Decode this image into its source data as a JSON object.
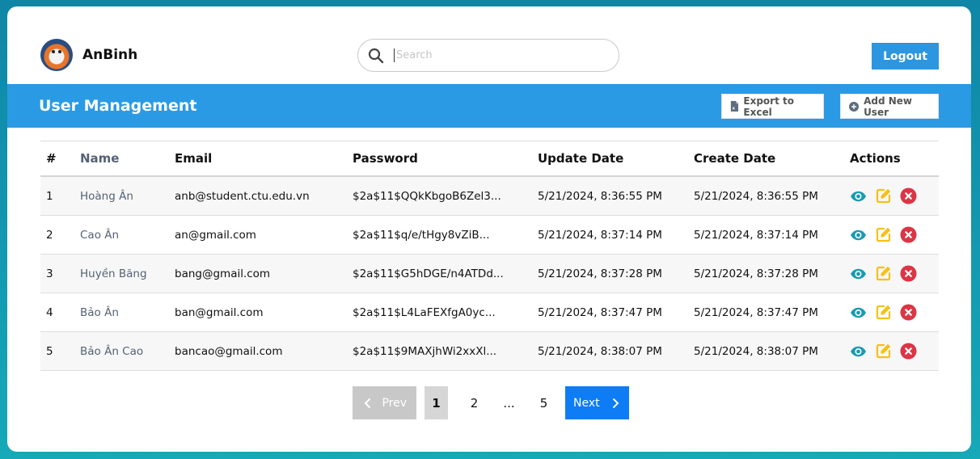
{
  "header": {
    "username": "AnBinh",
    "search_placeholder": "Search",
    "logout_label": "Logout"
  },
  "titlebar": {
    "title": "User Management",
    "export_label": "Export to Excel",
    "add_label": "Add New User"
  },
  "table": {
    "columns": [
      "#",
      "Name",
      "Email",
      "Password",
      "Update Date",
      "Create Date",
      "Actions"
    ],
    "rows": [
      {
        "num": "1",
        "name": "Hoàng Ân",
        "email": "anb@student.ctu.edu.vn",
        "password": "$2a$11$QQkKbgoB6Zel3...",
        "updated": "5/21/2024, 8:36:55 PM",
        "created": "5/21/2024, 8:36:55 PM"
      },
      {
        "num": "2",
        "name": "Cao Ân",
        "email": "an@gmail.com",
        "password": "$2a$11$q/e/tHgy8vZiB...",
        "updated": "5/21/2024, 8:37:14 PM",
        "created": "5/21/2024, 8:37:14 PM"
      },
      {
        "num": "3",
        "name": "Huyền Băng",
        "email": "bang@gmail.com",
        "password": "$2a$11$G5hDGE/n4ATDd...",
        "updated": "5/21/2024, 8:37:28 PM",
        "created": "5/21/2024, 8:37:28 PM"
      },
      {
        "num": "4",
        "name": "Bảo Ân",
        "email": "ban@gmail.com",
        "password": "$2a$11$L4LaFEXfgA0yc...",
        "updated": "5/21/2024, 8:37:47 PM",
        "created": "5/21/2024, 8:37:47 PM"
      },
      {
        "num": "5",
        "name": "Bảo Ân Cao",
        "email": "bancao@gmail.com",
        "password": "$2a$11$9MAXjhWi2xxXl...",
        "updated": "5/21/2024, 8:38:07 PM",
        "created": "5/21/2024, 8:38:07 PM"
      }
    ]
  },
  "pagination": {
    "prev_label": "Prev",
    "next_label": "Next",
    "pages": [
      "1",
      "2",
      "...",
      "5"
    ],
    "current": "1"
  },
  "colors": {
    "primary": "#2b9ae4",
    "view_icon": "#1a9bb0",
    "edit_icon": "#f6c019",
    "delete_icon": "#dc3545"
  },
  "icons": [
    "avatar",
    "search-icon",
    "excel-file-icon",
    "plus-circle-icon",
    "eye-icon",
    "edit-icon",
    "delete-icon",
    "chevron-left-icon",
    "chevron-right-icon"
  ]
}
